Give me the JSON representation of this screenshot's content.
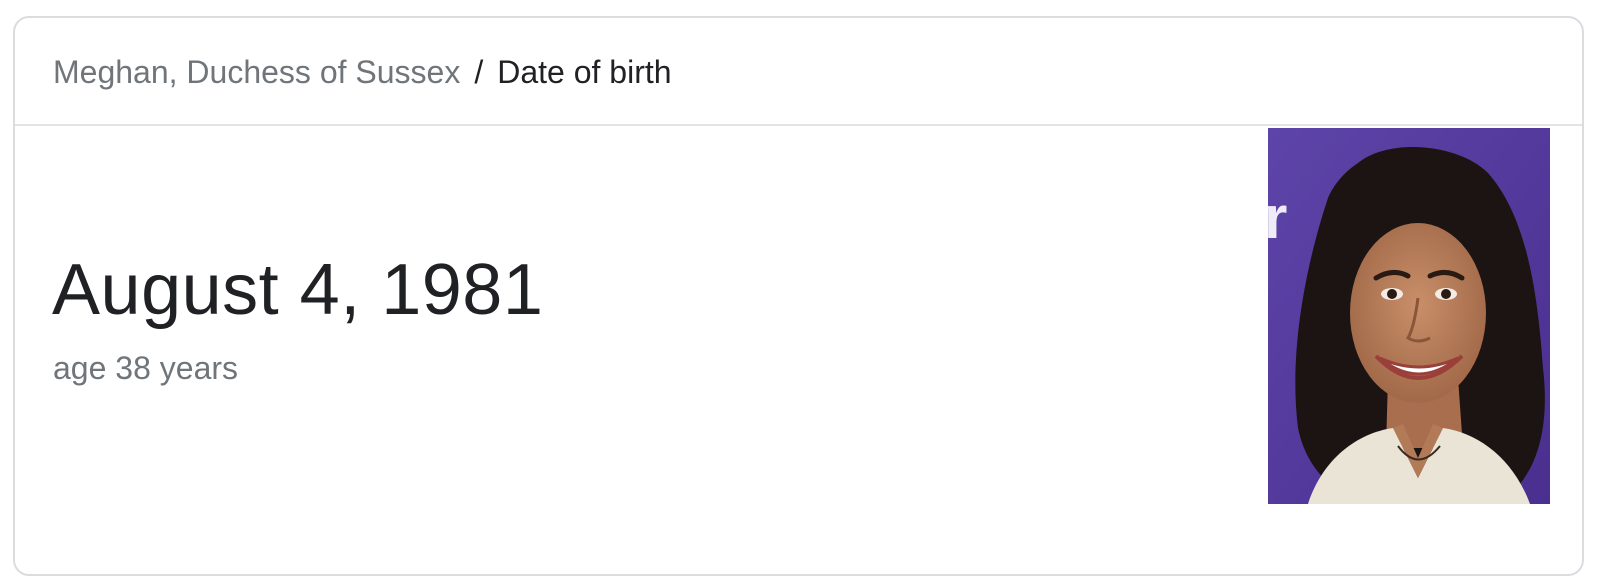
{
  "breadcrumb": {
    "parent": "Meghan, Duchess of Sussex",
    "separator": "/",
    "current": "Date of birth"
  },
  "answer": {
    "date": "August 4, 1981",
    "age": "age 38 years"
  },
  "image": {
    "subject": "portrait-photo",
    "background_color": "#5a3fa0"
  }
}
